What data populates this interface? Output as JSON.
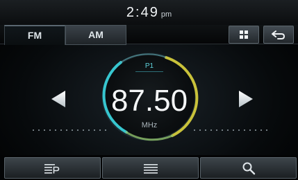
{
  "status_bar": {
    "time": "2:49",
    "ampm": "pm"
  },
  "tabs": [
    {
      "label": "FM",
      "active": true
    },
    {
      "label": "AM",
      "active": false
    }
  ],
  "top_icons": [
    "grid-menu-icon",
    "back-arrow-icon"
  ],
  "tuner": {
    "preset": "P1",
    "frequency": "87.50",
    "unit": "MHz"
  },
  "bottom_icons": [
    "preset-list-icon",
    "list-menu-icon",
    "search-icon"
  ],
  "colors": {
    "ring_cyan": "#37c6cf",
    "ring_yellow": "#c9c23a",
    "accent_text": "#5fd3de"
  }
}
